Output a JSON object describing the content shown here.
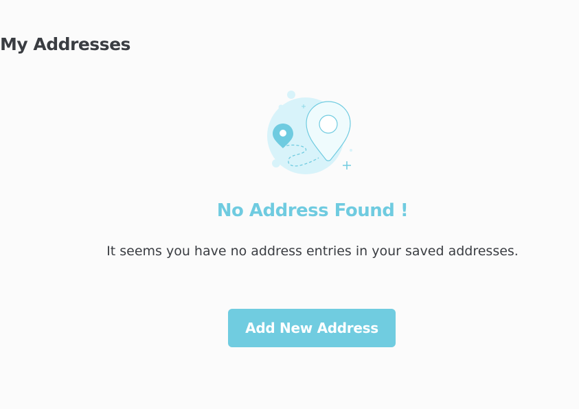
{
  "page": {
    "title": "My Addresses"
  },
  "empty_state": {
    "icon": "map-location-pins-icon",
    "title": "No Address Found !",
    "description": "It seems you have no address entries in your saved addresses.",
    "button_label": "Add New Address"
  },
  "colors": {
    "accent": "#70cce0",
    "text": "#3a3d42",
    "background": "#fbfbfb"
  }
}
